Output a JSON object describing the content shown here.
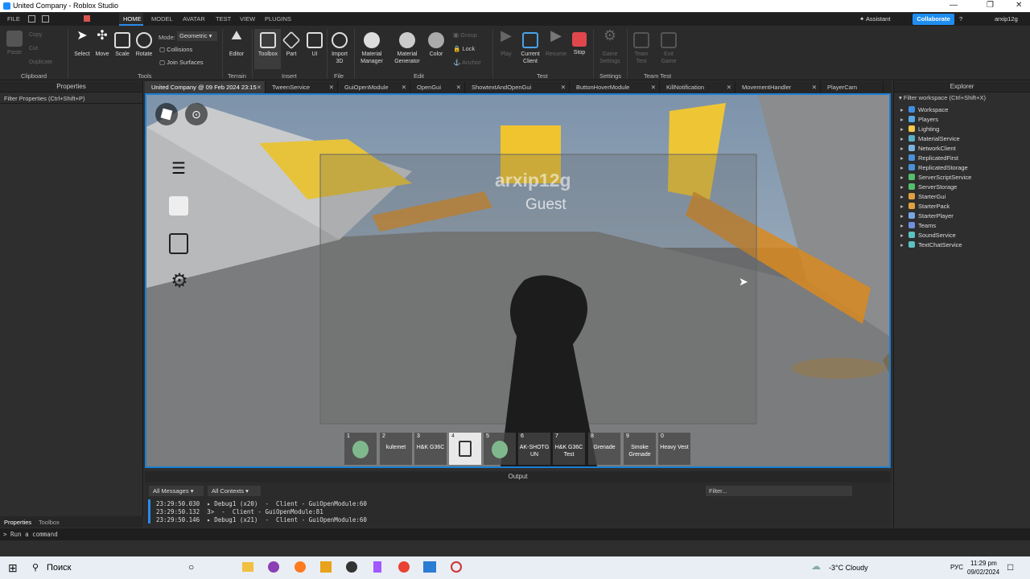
{
  "window": {
    "title": "United Company - Roblox Studio"
  },
  "menu": {
    "file": "FILE",
    "tabs": [
      "HOME",
      "MODEL",
      "AVATAR",
      "TEST",
      "VIEW",
      "PLUGINS"
    ],
    "assistant": "Assistant",
    "collaborate": "Collaborate",
    "user": "arxip12g"
  },
  "ribbon": {
    "clipboard": {
      "paste": "Paste",
      "copy": "Copy",
      "cut": "Cut",
      "duplicate": "Duplicate",
      "group": "Clipboard"
    },
    "tools": {
      "select": "Select",
      "move": "Move",
      "scale": "Scale",
      "rotate": "Rotate",
      "mode_label": "Mode:",
      "mode_value": "Geometric",
      "collisions": "Collisions",
      "join": "Join Surfaces",
      "group": "Tools"
    },
    "terrain": {
      "editor": "Editor",
      "group": "Terrain"
    },
    "insert": {
      "toolbox": "Toolbox",
      "part": "Part",
      "ui": "UI",
      "group": "Insert"
    },
    "file": {
      "import": "Import 3D",
      "group": "File"
    },
    "edit": {
      "mat_manager": "Material Manager",
      "mat_gen": "Material Generator",
      "color": "Color",
      "group_btn": "Group",
      "lock": "Lock",
      "anchor": "Anchor",
      "group": "Edit"
    },
    "test": {
      "play": "Play",
      "current_client": "Current Client",
      "resume": "Resume",
      "stop": "Stop",
      "group": "Test"
    },
    "settings": {
      "game_settings": "Game Settings",
      "group": "Settings"
    },
    "teamtest": {
      "team_test": "Team Test",
      "exit_game": "Exit Game",
      "group": "Team Test"
    }
  },
  "properties": {
    "title": "Properties",
    "filter": "Filter Properties (Ctrl+Shift+P)",
    "bottom_tabs": [
      "Properties",
      "Toolbox"
    ]
  },
  "doc_tabs": [
    "United Company @ 09 Feb 2024 23:15",
    "TweenService",
    "GuiOpenModule",
    "OpenGui",
    "ShowtextAndOpenGui",
    "ButtonHoverModule",
    "KillNotification",
    "MovementHandler",
    "PlayerCam"
  ],
  "game": {
    "player_name": "arxip12g",
    "player_rank": "Guest",
    "hotbar": [
      {
        "n": "1",
        "label": ""
      },
      {
        "n": "2",
        "label": "kulemet"
      },
      {
        "n": "3",
        "label": "H&K G36C"
      },
      {
        "n": "4",
        "label": ""
      },
      {
        "n": "5",
        "label": ""
      },
      {
        "n": "6",
        "label": "AK-SHOTG UN"
      },
      {
        "n": "7",
        "label": "H&K G36C Test"
      },
      {
        "n": "8",
        "label": "Grenade"
      },
      {
        "n": "9",
        "label": "Smoke Grenade"
      },
      {
        "n": "0",
        "label": "Heavy Vest"
      }
    ]
  },
  "explorer": {
    "title": "Explorer",
    "filter": "Filter workspace (Ctrl+Shift+X)",
    "items": [
      "Workspace",
      "Players",
      "Lighting",
      "MaterialService",
      "NetworkClient",
      "ReplicatedFirst",
      "ReplicatedStorage",
      "ServerScriptService",
      "ServerStorage",
      "StarterGui",
      "StarterPack",
      "StarterPlayer",
      "Teams",
      "SoundService",
      "TextChatService"
    ],
    "icon_colors": [
      "#3f8ee0",
      "#5aa9e6",
      "#f2c94c",
      "#5ab0c8",
      "#7bb3e0",
      "#4a90d9",
      "#4a90d9",
      "#55c06b",
      "#55c06b",
      "#e0a040",
      "#e0a040",
      "#7aa6e0",
      "#6f8fe0",
      "#5cc2c0",
      "#5cc2c0"
    ]
  },
  "output": {
    "title": "Output",
    "messages_filter": "All Messages",
    "contexts_filter": "All Contexts",
    "filter_placeholder": "Filter...",
    "lines": [
      "23:29:50.030  ▸ Debug1 (x20)  -  Client - GuiOpenModule:60",
      "23:29:50.132  3>  -  Client - GuiOpenModule:81",
      "23:29:50.146  ▸ Debug1 (x21)  -  Client - GuiOpenModule:60"
    ]
  },
  "command": {
    "placeholder": "Run a command"
  },
  "taskbar": {
    "search": "Поиск",
    "weather": "-3°C  Cloudy",
    "lang": "РУС",
    "time": "11:29 pm",
    "date": "09/02/2024"
  }
}
